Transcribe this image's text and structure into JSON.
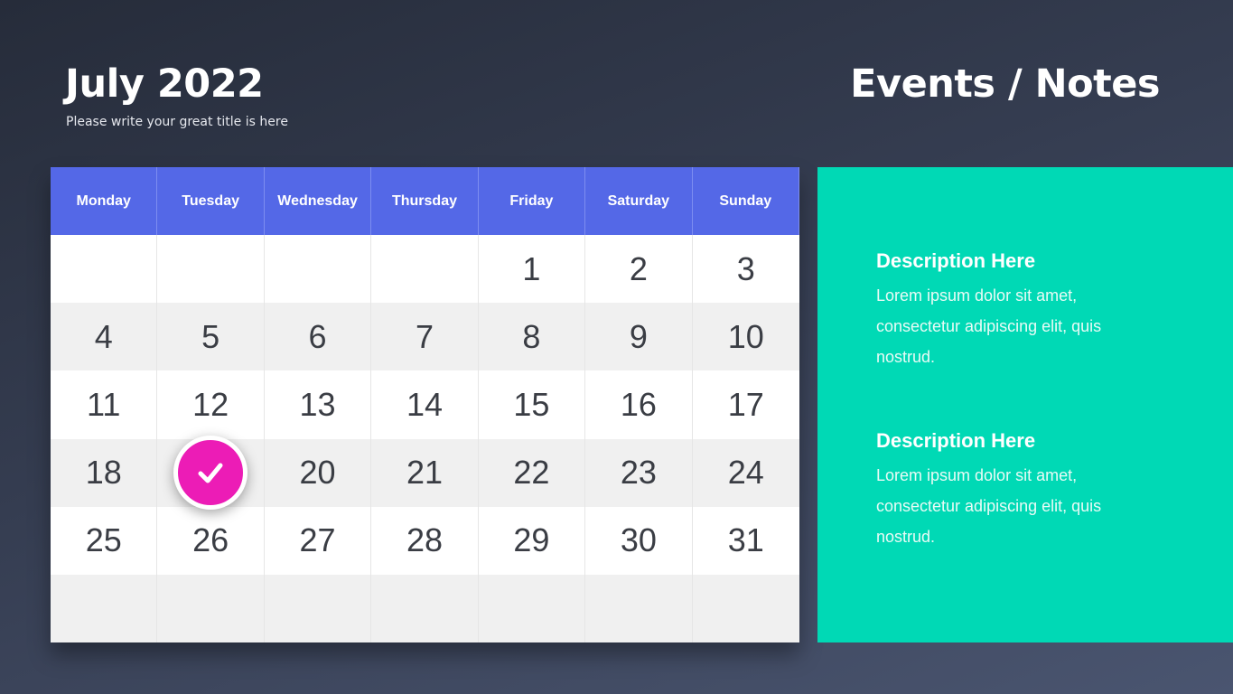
{
  "header": {
    "month_title": "July 2022",
    "subtitle": "Please write your great title is here",
    "events_title": "Events / Notes"
  },
  "calendar": {
    "weekdays": [
      "Monday",
      "Tuesday",
      "Wednesday",
      "Thursday",
      "Friday",
      "Saturday",
      "Sunday"
    ],
    "weeks": [
      [
        "",
        "",
        "",
        "",
        "1",
        "2",
        "3"
      ],
      [
        "4",
        "5",
        "6",
        "7",
        "8",
        "9",
        "10"
      ],
      [
        "11",
        "12",
        "13",
        "14",
        "15",
        "16",
        "17"
      ],
      [
        "18",
        "19",
        "20",
        "21",
        "22",
        "23",
        "24"
      ],
      [
        "25",
        "26",
        "27",
        "28",
        "29",
        "30",
        "31"
      ],
      [
        "",
        "",
        "",
        "",
        "",
        "",
        ""
      ]
    ],
    "checked_day": "19",
    "check_icon": "checkmark-icon"
  },
  "notes": [
    {
      "heading": "Description Here",
      "body": "Lorem ipsum dolor sit amet, consectetur adipiscing elit, quis nostrud."
    },
    {
      "heading": "Description Here",
      "body": "Lorem ipsum dolor sit amet, consectetur adipiscing elit, quis nostrud."
    }
  ],
  "colors": {
    "header_blue": "#5468e7",
    "panel_teal": "#00d9b5",
    "check_magenta": "#ec1cb6"
  }
}
